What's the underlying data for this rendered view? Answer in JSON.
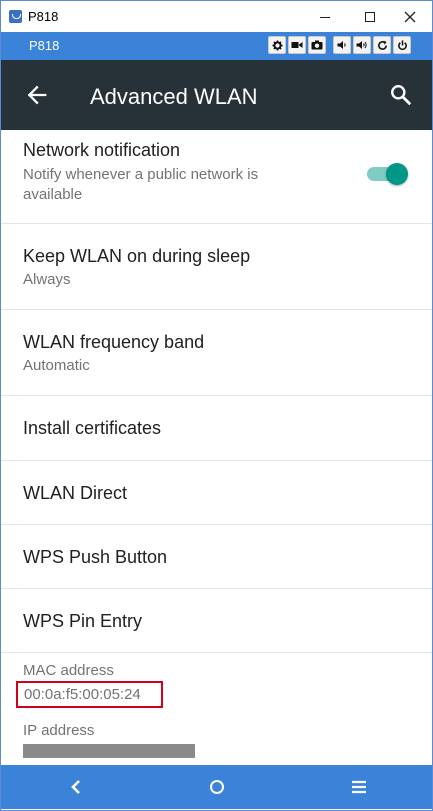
{
  "window": {
    "title": "P818",
    "icon": "app-icon"
  },
  "emulator": {
    "title": "P818",
    "buttons": [
      "gear-icon",
      "video-icon",
      "camera-icon",
      "volume-down-icon",
      "volume-up-icon",
      "rotate-icon",
      "power-icon"
    ]
  },
  "appbar": {
    "title": "Advanced WLAN",
    "background": "#263238"
  },
  "settings": {
    "network_notification": {
      "title": "Network notification",
      "subtitle_line1": "Notify whenever a public network is",
      "subtitle_line2": "available",
      "enabled": true
    },
    "keep_wlan": {
      "title": "Keep WLAN on during sleep",
      "subtitle": "Always"
    },
    "frequency_band": {
      "title": "WLAN frequency band",
      "subtitle": "Automatic"
    },
    "install_certificates": {
      "title": "Install certificates"
    },
    "wlan_direct": {
      "title": "WLAN Direct"
    },
    "wps_push": {
      "title": "WPS Push Button"
    },
    "wps_pin": {
      "title": "WPS Pin Entry"
    },
    "mac": {
      "label": "MAC address",
      "value": "00:0a:f5:00:05:24"
    },
    "ip": {
      "label": "IP address"
    }
  },
  "colors": {
    "accent": "#009688",
    "emulator_bar": "#3b82d9",
    "highlight_box": "#d0021b"
  }
}
